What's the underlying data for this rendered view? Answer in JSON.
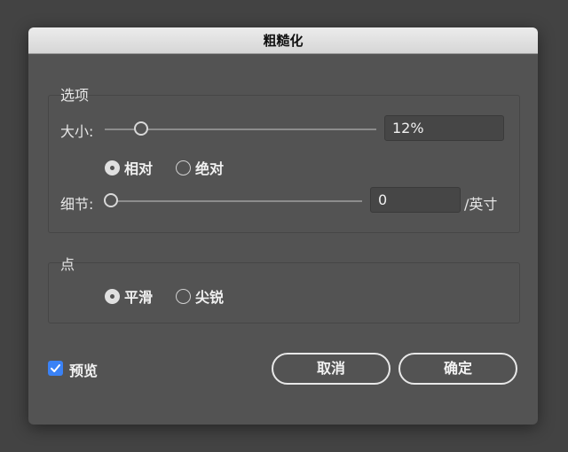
{
  "dialog": {
    "title": "粗糙化"
  },
  "options": {
    "group_title": "选项",
    "size": {
      "label": "大小:",
      "value": "12%",
      "slider_fraction": 0.13
    },
    "mode": {
      "relative_label": "相对",
      "absolute_label": "绝对",
      "selected": "relative"
    },
    "detail": {
      "label": "细节:",
      "value": "0",
      "unit": "/英寸",
      "slider_fraction": 0.0
    }
  },
  "points": {
    "group_title": "点",
    "smooth_label": "平滑",
    "sharp_label": "尖锐",
    "selected": "smooth"
  },
  "preview": {
    "label": "预览",
    "checked": true
  },
  "buttons": {
    "cancel": "取消",
    "ok": "确定"
  },
  "colors": {
    "accent": "#3a82f6",
    "dialog_bg": "#535353",
    "title_bg": "#e0e0e0"
  }
}
